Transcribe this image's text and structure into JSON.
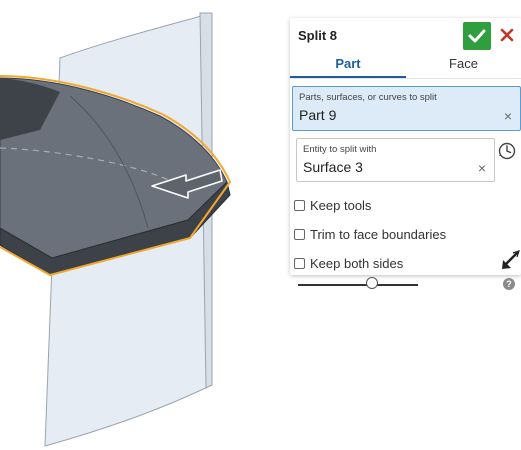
{
  "dialog": {
    "title": "Split 8",
    "accept_icon": "checkmark-icon",
    "cancel_icon": "close-icon",
    "accept_color": "#2e9e3f",
    "cancel_color": "#c0392b"
  },
  "tabs": [
    {
      "label": "Part",
      "active": true
    },
    {
      "label": "Face",
      "active": false
    }
  ],
  "fields": {
    "parts": {
      "label": "Parts, surfaces, or curves to split",
      "value": "Part 9",
      "active": true
    },
    "entity": {
      "label": "Entity to split with",
      "value": "Surface 3"
    }
  },
  "options": {
    "keep_tools": {
      "label": "Keep tools",
      "checked": false
    },
    "trim": {
      "label": "Trim to face boundaries",
      "checked": false
    },
    "keep_both": {
      "label": "Keep both sides",
      "checked": false
    }
  },
  "clear_glyph": "×",
  "help_glyph": "?",
  "slider": {
    "value_fraction": 0.62
  },
  "colors": {
    "accent": "#1f5c9e",
    "selection_outline": "#f0a830",
    "field_active_bg": "#dcebf7",
    "surface": "#e4eaf1"
  }
}
